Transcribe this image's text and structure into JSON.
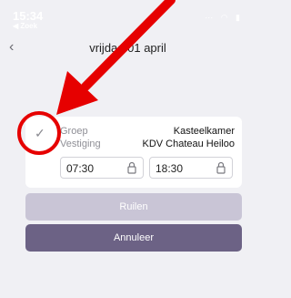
{
  "status_bar": {
    "time": "15:34",
    "back_label": "◀ Zoek"
  },
  "nav": {
    "title": "vrijdag 01 april"
  },
  "card": {
    "rows": [
      {
        "label": "Groep",
        "value": "Kasteelkamer"
      },
      {
        "label": "Vestiging",
        "value": "KDV Chateau Heiloo"
      }
    ],
    "start_time": "07:30",
    "end_time": "18:30"
  },
  "buttons": {
    "swap_label": "Ruilen",
    "cancel_label": "Annuleer"
  },
  "colors": {
    "background": "#f0f0f4",
    "swap_button": "#c9c5d6",
    "cancel_button": "#6c6285",
    "annotation": "#e60000"
  },
  "icons": [
    "back-chevron-icon",
    "check-icon",
    "lock-icon",
    "wifi-icon"
  ]
}
